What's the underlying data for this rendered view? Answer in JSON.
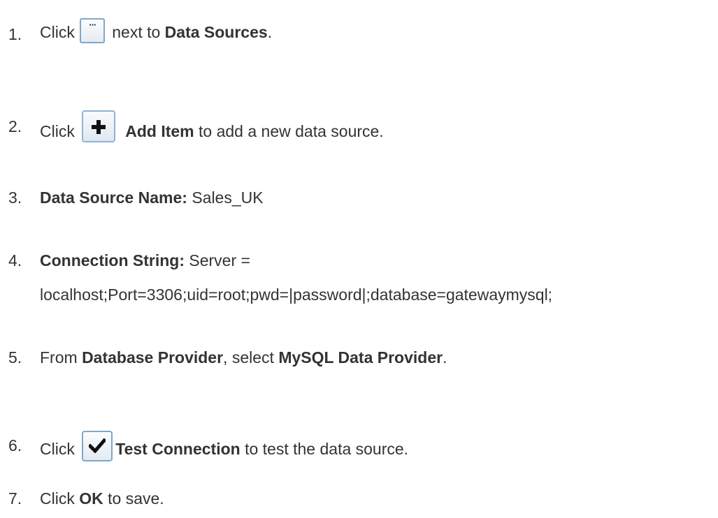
{
  "steps": [
    {
      "number": "1.",
      "parts": {
        "a": "Click",
        "icon": "ellipsis-icon",
        "b": "next to",
        "c": "Data Sources",
        "d": "."
      }
    },
    {
      "number": "2.",
      "parts": {
        "a": "Click",
        "icon": "plus-icon",
        "b": "Add Item",
        "c": "to add a new data source."
      }
    },
    {
      "number": "3.",
      "parts": {
        "a": "Data Source Name:",
        "b": "Sales_UK"
      }
    },
    {
      "number": "4.",
      "parts": {
        "a": "Connection String:",
        "b": "Server =",
        "c": "localhost;Port=3306;uid=root;pwd=|password|;database=gatewaymysql;"
      }
    },
    {
      "number": "5.",
      "parts": {
        "a": "From",
        "b": "Database Provider",
        "c": ", select",
        "d": "MySQL Data Provider",
        "e": "."
      }
    },
    {
      "number": "6.",
      "parts": {
        "a": "Click",
        "icon": "checkmark-icon",
        "b": "Test Connection",
        "c": "to test the data source."
      }
    },
    {
      "number": "7.",
      "parts": {
        "a": "Click",
        "b": "OK",
        "c": "to save."
      }
    }
  ],
  "colors": {
    "text": "#333333",
    "icon_border": "#7fa7c9"
  }
}
